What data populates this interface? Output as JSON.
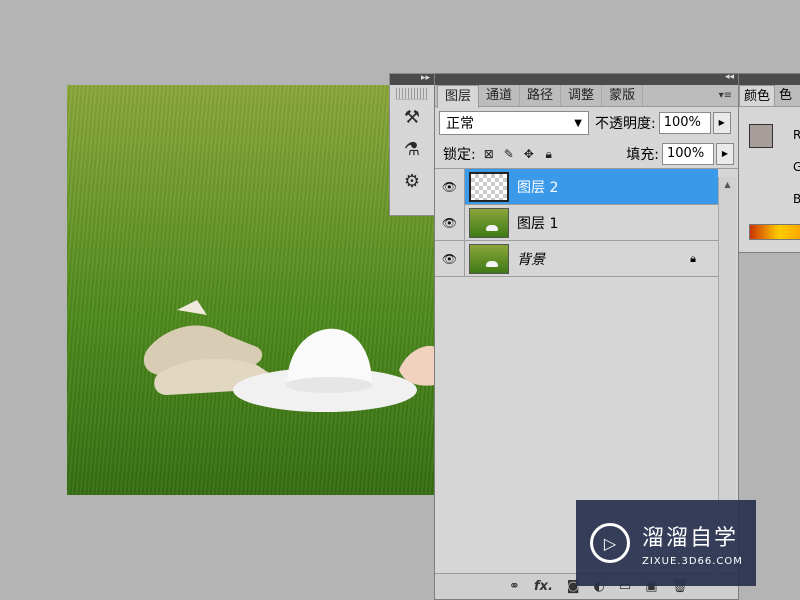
{
  "layers_panel": {
    "tabs": [
      "图层",
      "通道",
      "路径",
      "调整",
      "蒙版"
    ],
    "blend_mode": "正常",
    "opacity_label": "不透明度:",
    "opacity_value": "100%",
    "lock_label": "锁定:",
    "fill_label": "填充:",
    "fill_value": "100%",
    "layers": [
      {
        "name": "图层 2",
        "selected": true,
        "thumb": "transparent"
      },
      {
        "name": "图层 1",
        "selected": false,
        "thumb": "photo"
      },
      {
        "name": "背景",
        "selected": false,
        "thumb": "photo",
        "locked": true
      }
    ],
    "bottom_icons": [
      "link-icon",
      "fx-icon",
      "mask-icon",
      "adjustment-icon",
      "group-icon",
      "new-layer-icon",
      "trash-icon"
    ],
    "bottom_fx_label": "fx."
  },
  "color_panel": {
    "tabs": [
      "颜色",
      "色"
    ],
    "channels": [
      "R",
      "G",
      "B"
    ],
    "foreground": "#a79e9c",
    "background": "#ffffff"
  },
  "watermark": {
    "title": "溜溜自学",
    "url": "ZIXUE.3D66.COM"
  }
}
